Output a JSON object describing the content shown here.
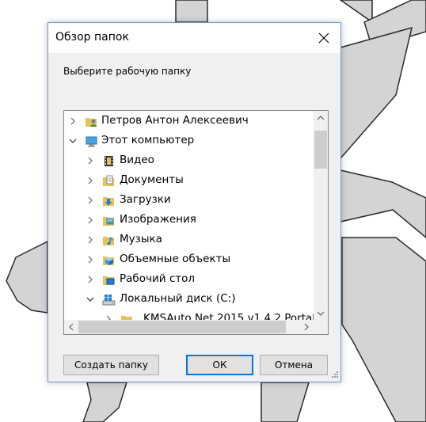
{
  "dialog": {
    "title": "Обзор папок",
    "prompt": "Выберите рабочую папку",
    "tree": [
      {
        "label": "Петров Антон Алексеевич",
        "icon": "user-folder-icon",
        "state": "collapsed",
        "level": 0
      },
      {
        "label": "Этот компьютер",
        "icon": "computer-icon",
        "state": "expanded",
        "level": 0
      },
      {
        "label": "Видео",
        "icon": "video-folder-icon",
        "state": "collapsed",
        "level": 1
      },
      {
        "label": "Документы",
        "icon": "documents-folder-icon",
        "state": "collapsed",
        "level": 1
      },
      {
        "label": "Загрузки",
        "icon": "downloads-folder-icon",
        "state": "collapsed",
        "level": 1
      },
      {
        "label": "Изображения",
        "icon": "pictures-folder-icon",
        "state": "collapsed",
        "level": 1
      },
      {
        "label": "Музыка",
        "icon": "music-folder-icon",
        "state": "collapsed",
        "level": 1
      },
      {
        "label": "Объемные объекты",
        "icon": "3d-objects-folder-icon",
        "state": "collapsed",
        "level": 1
      },
      {
        "label": "Рабочий стол",
        "icon": "desktop-folder-icon",
        "state": "collapsed",
        "level": 1
      },
      {
        "label": "Локальный диск (C:)",
        "icon": "local-disk-icon",
        "state": "expanded",
        "level": 1
      },
      {
        "label": "KMSAuto Net 2015 v1.4.2 Portab",
        "icon": "folder-icon",
        "state": "collapsed",
        "level": 2
      }
    ],
    "buttons": {
      "new_folder": "Создать папку",
      "ok": "ОК",
      "cancel": "Отмена"
    },
    "accent_color": "#0078d7"
  }
}
